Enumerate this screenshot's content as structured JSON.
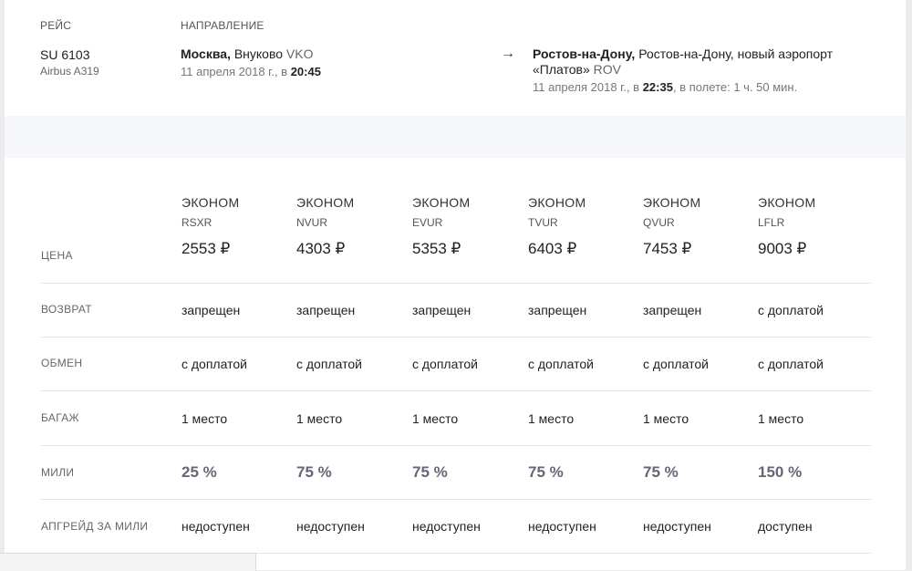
{
  "flight": {
    "col_flight_label": "РЕЙС",
    "col_direction_label": "НАПРАВЛЕНИЕ",
    "number": "SU 6103",
    "aircraft": "Airbus A319",
    "departure": {
      "city": "Москва,",
      "airport": "Внуково",
      "code": "VKO",
      "date_prefix": "11 апреля 2018 г., в",
      "time": "20:45"
    },
    "arrow": "→",
    "arrival": {
      "city": "Ростов-на-Дону,",
      "airport": "Ростов-на-Дону, новый аэропорт",
      "airport_line2": "«Платов»",
      "code": "ROV",
      "date_prefix": "11 апреля 2018 г., в",
      "time": "22:35",
      "duration": ", в полете: 1 ч. 50 мин."
    }
  },
  "fares": {
    "row_labels": {
      "price": "ЦЕНА",
      "refund": "ВОЗВРАТ",
      "exchange": "ОБМЕН",
      "baggage": "БАГАЖ",
      "miles": "МИЛИ",
      "upgrade": "АПГРЕЙД ЗА МИЛИ"
    },
    "columns": [
      {
        "class": "ЭКОНОМ",
        "code": "RSXR",
        "price": "2553 ₽",
        "refund": "запрещен",
        "exchange": "с доплатой",
        "baggage": "1 место",
        "miles": "25 %",
        "upgrade": "недоступен"
      },
      {
        "class": "ЭКОНОМ",
        "code": "NVUR",
        "price": "4303 ₽",
        "refund": "запрещен",
        "exchange": "с доплатой",
        "baggage": "1 место",
        "miles": "75 %",
        "upgrade": "недоступен"
      },
      {
        "class": "ЭКОНОМ",
        "code": "EVUR",
        "price": "5353 ₽",
        "refund": "запрещен",
        "exchange": "с доплатой",
        "baggage": "1 место",
        "miles": "75 %",
        "upgrade": "недоступен"
      },
      {
        "class": "ЭКОНОМ",
        "code": "TVUR",
        "price": "6403 ₽",
        "refund": "запрещен",
        "exchange": "с доплатой",
        "baggage": "1 место",
        "miles": "75 %",
        "upgrade": "недоступен"
      },
      {
        "class": "ЭКОНОМ",
        "code": "QVUR",
        "price": "7453 ₽",
        "refund": "запрещен",
        "exchange": "с доплатой",
        "baggage": "1 место",
        "miles": "75 %",
        "upgrade": "недоступен"
      },
      {
        "class": "ЭКОНОМ",
        "code": "LFLR",
        "price": "9003 ₽",
        "refund": "с доплатой",
        "exchange": "с доплатой",
        "baggage": "1 место",
        "miles": "150 %",
        "upgrade": "доступен"
      }
    ]
  }
}
